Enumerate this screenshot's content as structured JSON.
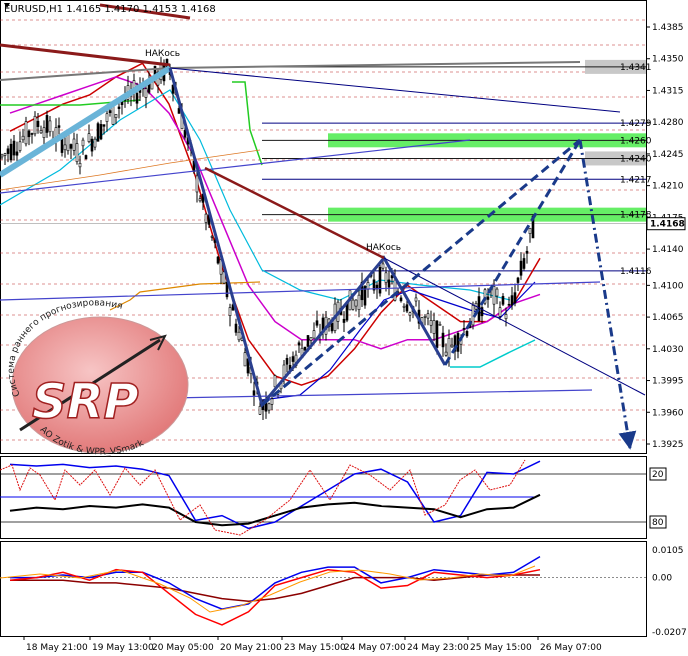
{
  "window": {
    "symbol_line": "EURUSD,H1  1.4165 1.4170 1.4153 1.4168"
  },
  "chart_data": [
    {
      "type": "line",
      "panel": "main",
      "title": "EURUSD,H1  1.4165 1.4170 1.4153 1.4168",
      "ylim": [
        1.3905,
        1.4415
      ],
      "y_ticks": [
        "1.4385",
        "1.4350",
        "1.4315",
        "1.4280",
        "1.4245",
        "1.4210",
        "1.4175",
        "1.4140",
        "1.4100",
        "1.4065",
        "1.4030",
        "1.3995",
        "1.3960",
        "1.3925"
      ],
      "x_ticks": [
        "18 May 21:00",
        "19 May 13:00",
        "20 May 05:00",
        "20 May 21:00",
        "23 May 15:00",
        "24 May 07:00",
        "24 May 23:00",
        "25 May 15:00",
        "26 May 07:00"
      ],
      "current_price": "1.4168",
      "price_level_labels": [
        {
          "label": "1.4341",
          "value": 1.4341,
          "color": "#c0c0c0"
        },
        {
          "label": "1.4279",
          "value": 1.4279,
          "color": "#000080"
        },
        {
          "label": "1.4260",
          "value": 1.426,
          "color": "#66ee66"
        },
        {
          "label": "1.4240",
          "value": 1.424,
          "color": "#c0c0c0"
        },
        {
          "label": "1.4217",
          "value": 1.4217,
          "color": "#000080"
        },
        {
          "label": "1.4178",
          "value": 1.4178,
          "color": "#66ee66"
        },
        {
          "label": "1.4116",
          "value": 1.4116,
          "color": "#000080"
        }
      ],
      "annotations": [
        "НАКось",
        "НАКось"
      ],
      "series": [
        {
          "name": "",
          "color": "#cc0000",
          "values": [
            1.427,
            1.4285,
            1.43,
            1.431,
            1.433,
            1.4345,
            1.43,
            1.422,
            1.412,
            1.404,
            1.4,
            1.399,
            1.4,
            1.403,
            1.407,
            1.41,
            1.408,
            1.406,
            1.406,
            1.408,
            1.413
          ]
        },
        {
          "name": "",
          "color": "#cc00cc",
          "values": [
            1.429,
            1.43,
            1.431,
            1.432,
            1.433,
            1.432,
            1.429,
            1.424,
            1.417,
            1.41,
            1.406,
            1.404,
            1.404,
            1.404,
            1.403,
            1.404,
            1.404,
            1.405,
            1.406,
            1.408,
            1.409
          ]
        }
      ]
    },
    {
      "type": "line",
      "panel": "oscillator_1",
      "y_ticks": [
        "20",
        "80"
      ],
      "series": [
        {
          "name": "",
          "color": "#0000ee",
          "values": [
            8,
            10,
            8,
            12,
            10,
            14,
            22,
            78,
            72,
            88,
            80,
            60,
            40,
            20,
            14,
            30,
            80,
            72,
            18,
            20,
            4
          ]
        },
        {
          "name": "",
          "color": "#000000",
          "values": [
            66,
            62,
            64,
            60,
            62,
            58,
            62,
            80,
            84,
            82,
            72,
            62,
            58,
            56,
            60,
            62,
            64,
            74,
            64,
            62,
            46
          ]
        }
      ]
    },
    {
      "type": "line",
      "panel": "oscillator_2",
      "y_ticks": [
        "0.0105",
        "0.00",
        "-0.0207"
      ],
      "ylim": [
        -0.0207,
        0.0105
      ],
      "series": [
        {
          "name": "",
          "color": "#8b0000",
          "values": [
            -0.001,
            -0.001,
            -0.001,
            -0.002,
            -0.002,
            -0.003,
            -0.004,
            -0.006,
            -0.008,
            -0.009,
            -0.008,
            -0.006,
            -0.003,
            0.0,
            0.0,
            0.0,
            -0.001,
            0.0,
            0.001,
            0.001,
            0.001
          ]
        },
        {
          "name": "",
          "color": "#0000ee",
          "values": [
            0.0,
            0.0,
            0.001,
            0.0,
            0.002,
            0.002,
            -0.002,
            -0.008,
            -0.012,
            -0.01,
            -0.002,
            0.002,
            0.004,
            0.004,
            -0.002,
            0.0,
            0.003,
            0.002,
            0.001,
            0.002,
            0.008
          ]
        },
        {
          "name": "",
          "color": "#ff0000",
          "values": [
            -0.001,
            0.0,
            0.002,
            -0.001,
            0.003,
            0.002,
            -0.006,
            -0.014,
            -0.018,
            -0.013,
            -0.003,
            0.0,
            0.003,
            0.002,
            -0.004,
            -0.003,
            0.002,
            0.001,
            0.0,
            0.001,
            0.003
          ]
        }
      ]
    }
  ],
  "watermark": {
    "logo_letters": "SRP",
    "arc_top": "Система раннего прогнозирования",
    "arc_bottom": "AO Zotik & WPR_VSmark"
  }
}
